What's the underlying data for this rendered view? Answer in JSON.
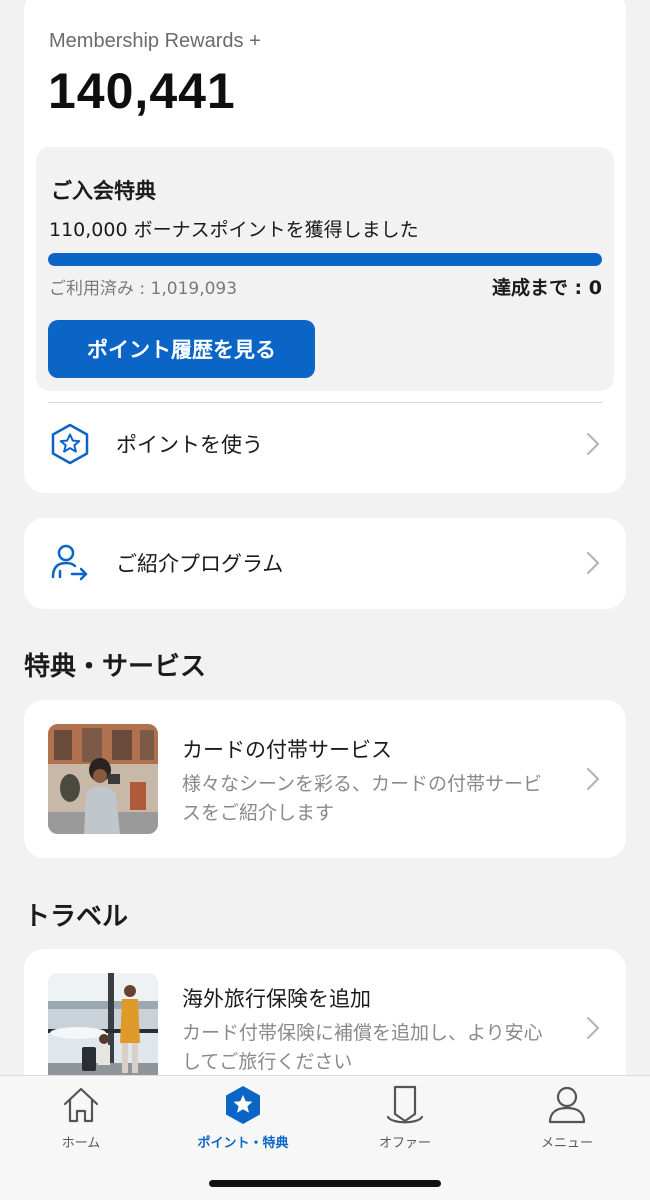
{
  "points_card": {
    "program_name": "Membership Rewards +",
    "points": "140,441",
    "bonus": {
      "title": "ご入会特典",
      "description": "110,000 ボーナスポイントを獲得しました",
      "progress_fraction": 1.0,
      "used": "ご利用済み : 1,019,093",
      "remaining": "達成まで : 0",
      "history_button": "ポイント履歴を見る"
    },
    "use_points_label": "ポイントを使う"
  },
  "referral": {
    "label": "ご紹介プログラム"
  },
  "benefits_section": {
    "title": "特典・サービス",
    "items": [
      {
        "title": "カードの付帯サービス",
        "description": "様々なシーンを彩る、カードの付帯サービスをご紹介します"
      }
    ]
  },
  "travel_section": {
    "title": "トラベル",
    "items": [
      {
        "title": "海外旅行保険を追加",
        "description": "カード付帯保険に補償を追加し、より安心してご旅行ください"
      }
    ]
  },
  "tabbar": {
    "tabs": [
      {
        "label": "ホーム",
        "icon": "home-icon",
        "active": false
      },
      {
        "label": "ポイント・特典",
        "icon": "star-badge-icon",
        "active": true
      },
      {
        "label": "オファー",
        "icon": "offer-tag-icon",
        "active": false
      },
      {
        "label": "メニュー",
        "icon": "person-icon",
        "active": false
      }
    ]
  },
  "colors": {
    "accent": "#0a65c7",
    "background": "#f2f2f2",
    "muted_text": "#8a8a8a"
  }
}
